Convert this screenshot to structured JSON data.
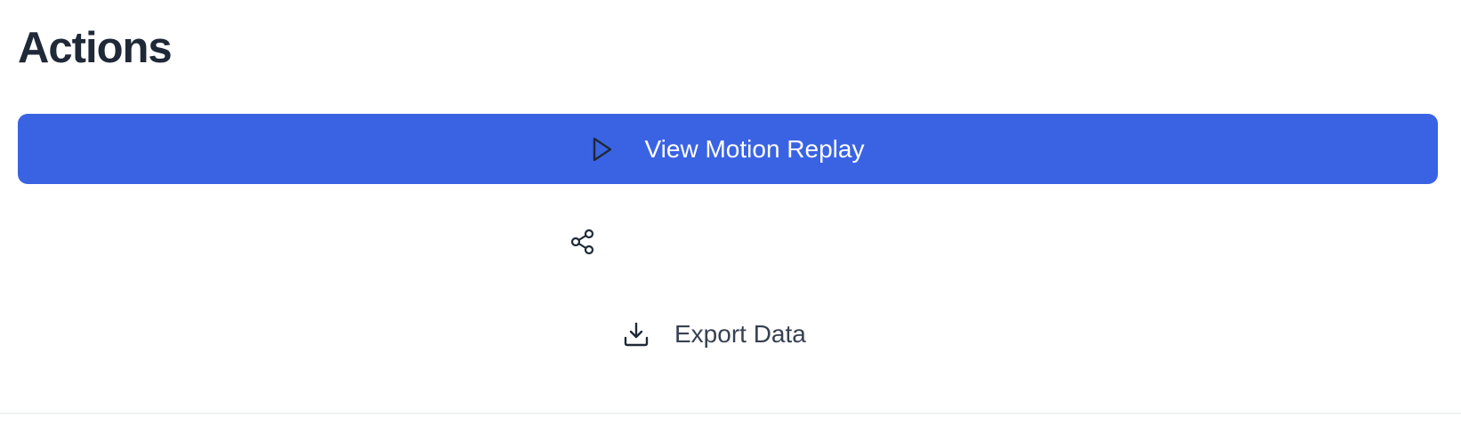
{
  "section": {
    "title": "Actions"
  },
  "actions": {
    "replay": {
      "label": "View Motion Replay",
      "icon": "play-icon"
    },
    "share": {
      "label": "",
      "icon": "share-icon"
    },
    "export": {
      "label": "Export Data",
      "icon": "download-icon"
    }
  },
  "colors": {
    "primary": "#3a63e4",
    "title_text": "#1f2937",
    "secondary_text": "#374151"
  }
}
